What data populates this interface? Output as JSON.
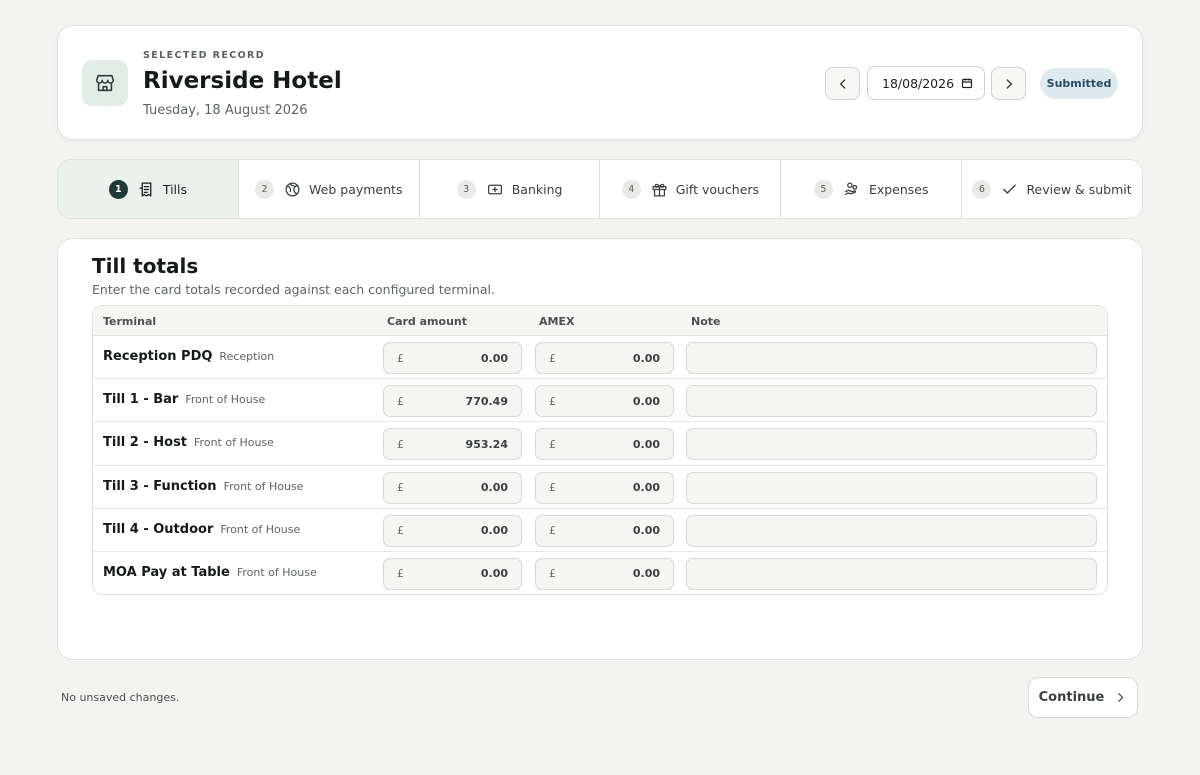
{
  "header": {
    "eyebrow": "SELECTED RECORD",
    "title": "Riverside Hotel",
    "subtitle": "Tuesday, 18 August 2026",
    "date_value": "18/08/2026",
    "status": "Submitted",
    "icons": {
      "store": "store-icon",
      "prev": "chevron-left-icon",
      "next": "chevron-right-icon",
      "calendar": "calendar-icon"
    }
  },
  "steps": [
    {
      "num": "1",
      "label": "Tills",
      "icon": "receipt-icon",
      "active": true
    },
    {
      "num": "2",
      "label": "Web payments",
      "icon": "globe-icon",
      "active": false
    },
    {
      "num": "3",
      "label": "Banking",
      "icon": "cash-icon",
      "active": false
    },
    {
      "num": "4",
      "label": "Gift vouchers",
      "icon": "gift-icon",
      "active": false
    },
    {
      "num": "5",
      "label": "Expenses",
      "icon": "hand-coins-icon",
      "active": false
    },
    {
      "num": "6",
      "label": "Review & submit",
      "icon": "check-icon",
      "active": false
    }
  ],
  "main": {
    "title": "Till totals",
    "description": "Enter the card totals recorded against each configured terminal.",
    "columns": [
      "Terminal",
      "Card amount",
      "AMEX",
      "Note"
    ],
    "currency": "£",
    "rows": [
      {
        "name": "Reception PDQ",
        "location": "Reception",
        "card": "0.00",
        "amex": "0.00",
        "note": ""
      },
      {
        "name": "Till 1 - Bar",
        "location": "Front of House",
        "card": "770.49",
        "amex": "0.00",
        "note": ""
      },
      {
        "name": "Till 2 - Host",
        "location": "Front of House",
        "card": "953.24",
        "amex": "0.00",
        "note": ""
      },
      {
        "name": "Till 3 - Function",
        "location": "Front of House",
        "card": "0.00",
        "amex": "0.00",
        "note": ""
      },
      {
        "name": "Till 4 - Outdoor",
        "location": "Front of House",
        "card": "0.00",
        "amex": "0.00",
        "note": ""
      },
      {
        "name": "MOA Pay at Table",
        "location": "Front of House",
        "card": "0.00",
        "amex": "0.00",
        "note": ""
      }
    ]
  },
  "footer": {
    "status": "No unsaved changes.",
    "continue_label": "Continue",
    "continue_icon": "chevron-right-icon"
  }
}
